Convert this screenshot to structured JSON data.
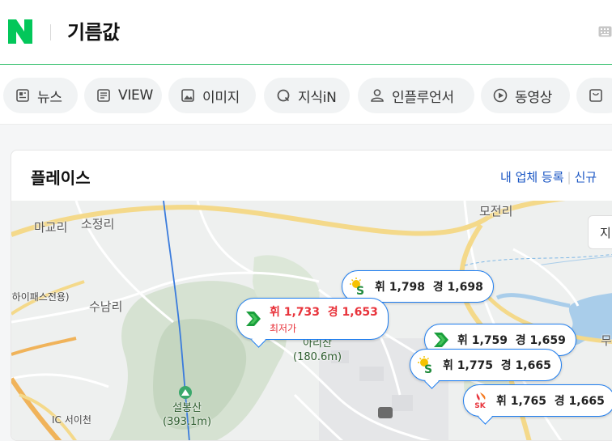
{
  "header": {
    "query": "기름값"
  },
  "tabs": [
    {
      "label": "뉴스",
      "icon": "news-icon"
    },
    {
      "label": "VIEW",
      "icon": "view-icon"
    },
    {
      "label": "이미지",
      "icon": "image-icon"
    },
    {
      "label": "지식iN",
      "icon": "kin-icon"
    },
    {
      "label": "인플루언서",
      "icon": "person-icon"
    },
    {
      "label": "동영상",
      "icon": "play-icon"
    },
    {
      "label": "",
      "icon": "shopping-icon"
    }
  ],
  "place": {
    "title": "플레이스",
    "register_link": "내 업체 등록",
    "new_link": "신규",
    "side_button": "지"
  },
  "map_labels": {
    "magyori": "마교리",
    "sojeongri": "소정리",
    "hipass": "(하이패스전용)",
    "sunamri": "수남리",
    "arisan": "아리산",
    "arisan_height": "(180.6m)",
    "seolbongsan": "설봉산",
    "seolbongsan_height": "(393.1m)",
    "mojeonri": "모전리",
    "mu": "무",
    "ic": "IC 서이천"
  },
  "markers": [
    {
      "brand": "s-oil",
      "gasoline": "휘 1,798",
      "diesel": "경 1,698"
    },
    {
      "brand": "sk-energy-green",
      "gasoline": "휘 1,733",
      "diesel": "경 1,653",
      "note": "최저가"
    },
    {
      "brand": "sk-energy-green",
      "gasoline": "휘 1,759",
      "diesel": "경 1,659"
    },
    {
      "brand": "s-oil",
      "gasoline": "휘 1,775",
      "diesel": "경 1,665"
    },
    {
      "brand": "sk",
      "gasoline": "휘 1,765",
      "diesel": "경 1,665"
    }
  ],
  "colors": {
    "naver_green": "#03c75a",
    "marker_border": "#1f7ef0",
    "lowest_red": "#e8333b",
    "link_blue": "#1a56c4"
  }
}
